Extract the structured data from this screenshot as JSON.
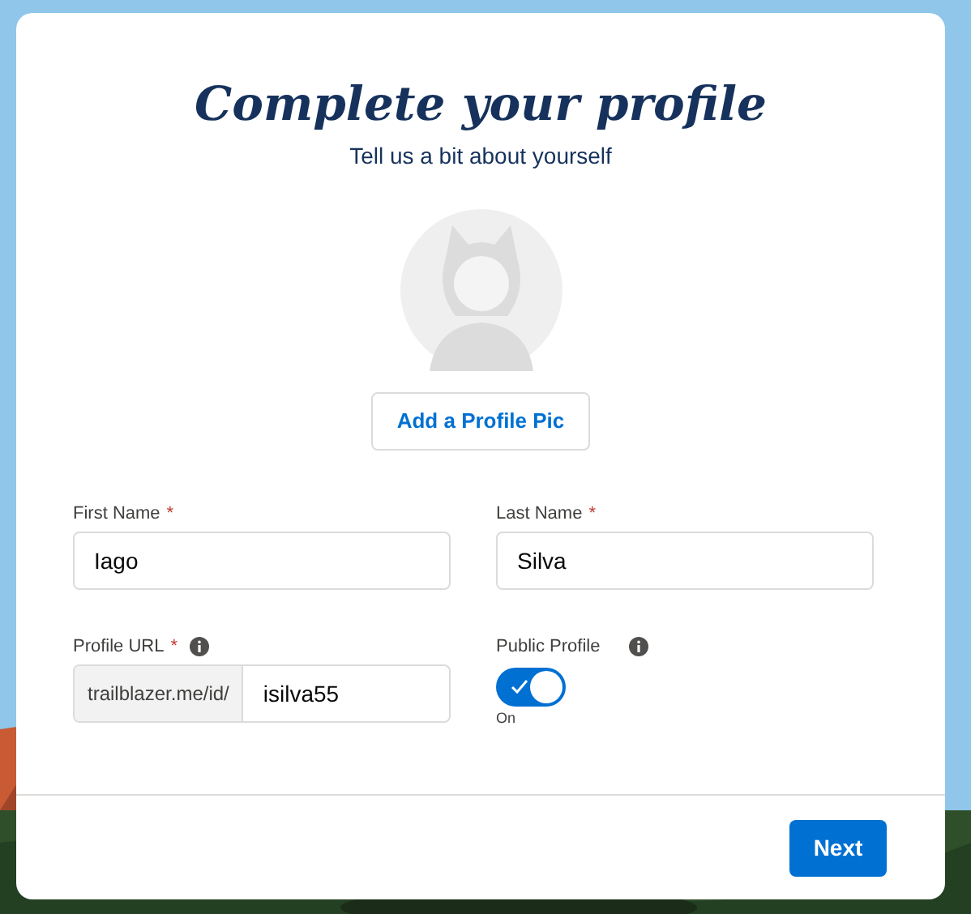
{
  "title": "Complete your profile",
  "subtitle": "Tell us a bit about yourself",
  "add_photo_button": "Add a Profile Pic",
  "name_fields": [
    {
      "label": "First Name",
      "required_mark": "*",
      "value": "Iago"
    },
    {
      "label": "Last Name",
      "required_mark": "*",
      "value": "Silva"
    }
  ],
  "profile_url": {
    "label": "Profile URL",
    "required_mark": "*",
    "prefix": "trailblazer.me/id/",
    "value": "isilva55"
  },
  "public_profile": {
    "label": "Public Profile",
    "on": true,
    "state_text": "On"
  },
  "next_button": "Next"
}
